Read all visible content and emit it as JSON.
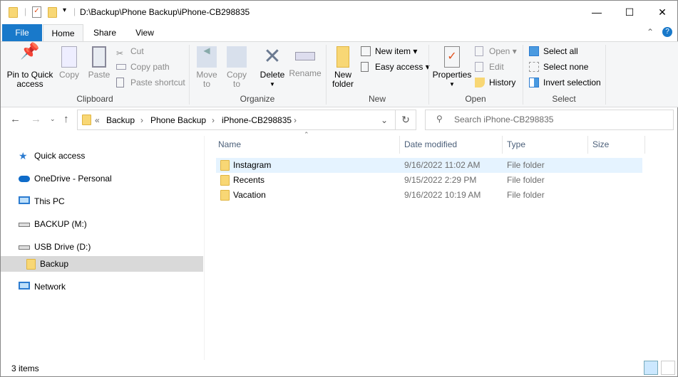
{
  "window": {
    "title": "D:\\Backup\\Phone Backup\\iPhone-CB298835",
    "minimize": "—",
    "maximize": "☐",
    "close": "✕"
  },
  "tabs": [
    {
      "label": "File"
    },
    {
      "label": "Home"
    },
    {
      "label": "Share"
    },
    {
      "label": "View"
    }
  ],
  "ribbon": {
    "clipboard": {
      "label": "Clipboard",
      "pin": "Pin to Quick access",
      "copy": "Copy",
      "paste": "Paste",
      "cut": "Cut",
      "copy_path": "Copy path",
      "paste_shortcut": "Paste shortcut"
    },
    "organize": {
      "label": "Organize",
      "move_to": "Move to",
      "copy_to": "Copy to",
      "delete": "Delete",
      "rename": "Rename"
    },
    "new": {
      "label": "New",
      "new_folder": "New folder",
      "new_item": "New item",
      "easy_access": "Easy access"
    },
    "open": {
      "label": "Open",
      "properties": "Properties",
      "open": "Open",
      "edit": "Edit",
      "history": "History"
    },
    "select": {
      "label": "Select",
      "select_all": "Select all",
      "select_none": "Select none",
      "invert": "Invert selection"
    }
  },
  "address": {
    "crumbs": [
      "Backup",
      "Phone Backup",
      "iPhone-CB298835"
    ],
    "overflow": "«"
  },
  "search": {
    "placeholder": "Search iPhone-CB298835"
  },
  "sidebar": [
    {
      "label": "Quick access"
    },
    {
      "label": "OneDrive - Personal"
    },
    {
      "label": "This PC"
    },
    {
      "label": "BACKUP (M:)"
    },
    {
      "label": "USB Drive (D:)"
    },
    {
      "label": "Backup"
    },
    {
      "label": "Network"
    }
  ],
  "columns": {
    "name": "Name",
    "date": "Date modified",
    "type": "Type",
    "size": "Size"
  },
  "files": [
    {
      "name": "Instagram",
      "date": "9/16/2022 11:02 AM",
      "type": "File folder"
    },
    {
      "name": "Recents",
      "date": "9/15/2022 2:29 PM",
      "type": "File folder"
    },
    {
      "name": "Vacation",
      "date": "9/16/2022 10:19 AM",
      "type": "File folder"
    }
  ],
  "status": {
    "count": "3 items"
  }
}
